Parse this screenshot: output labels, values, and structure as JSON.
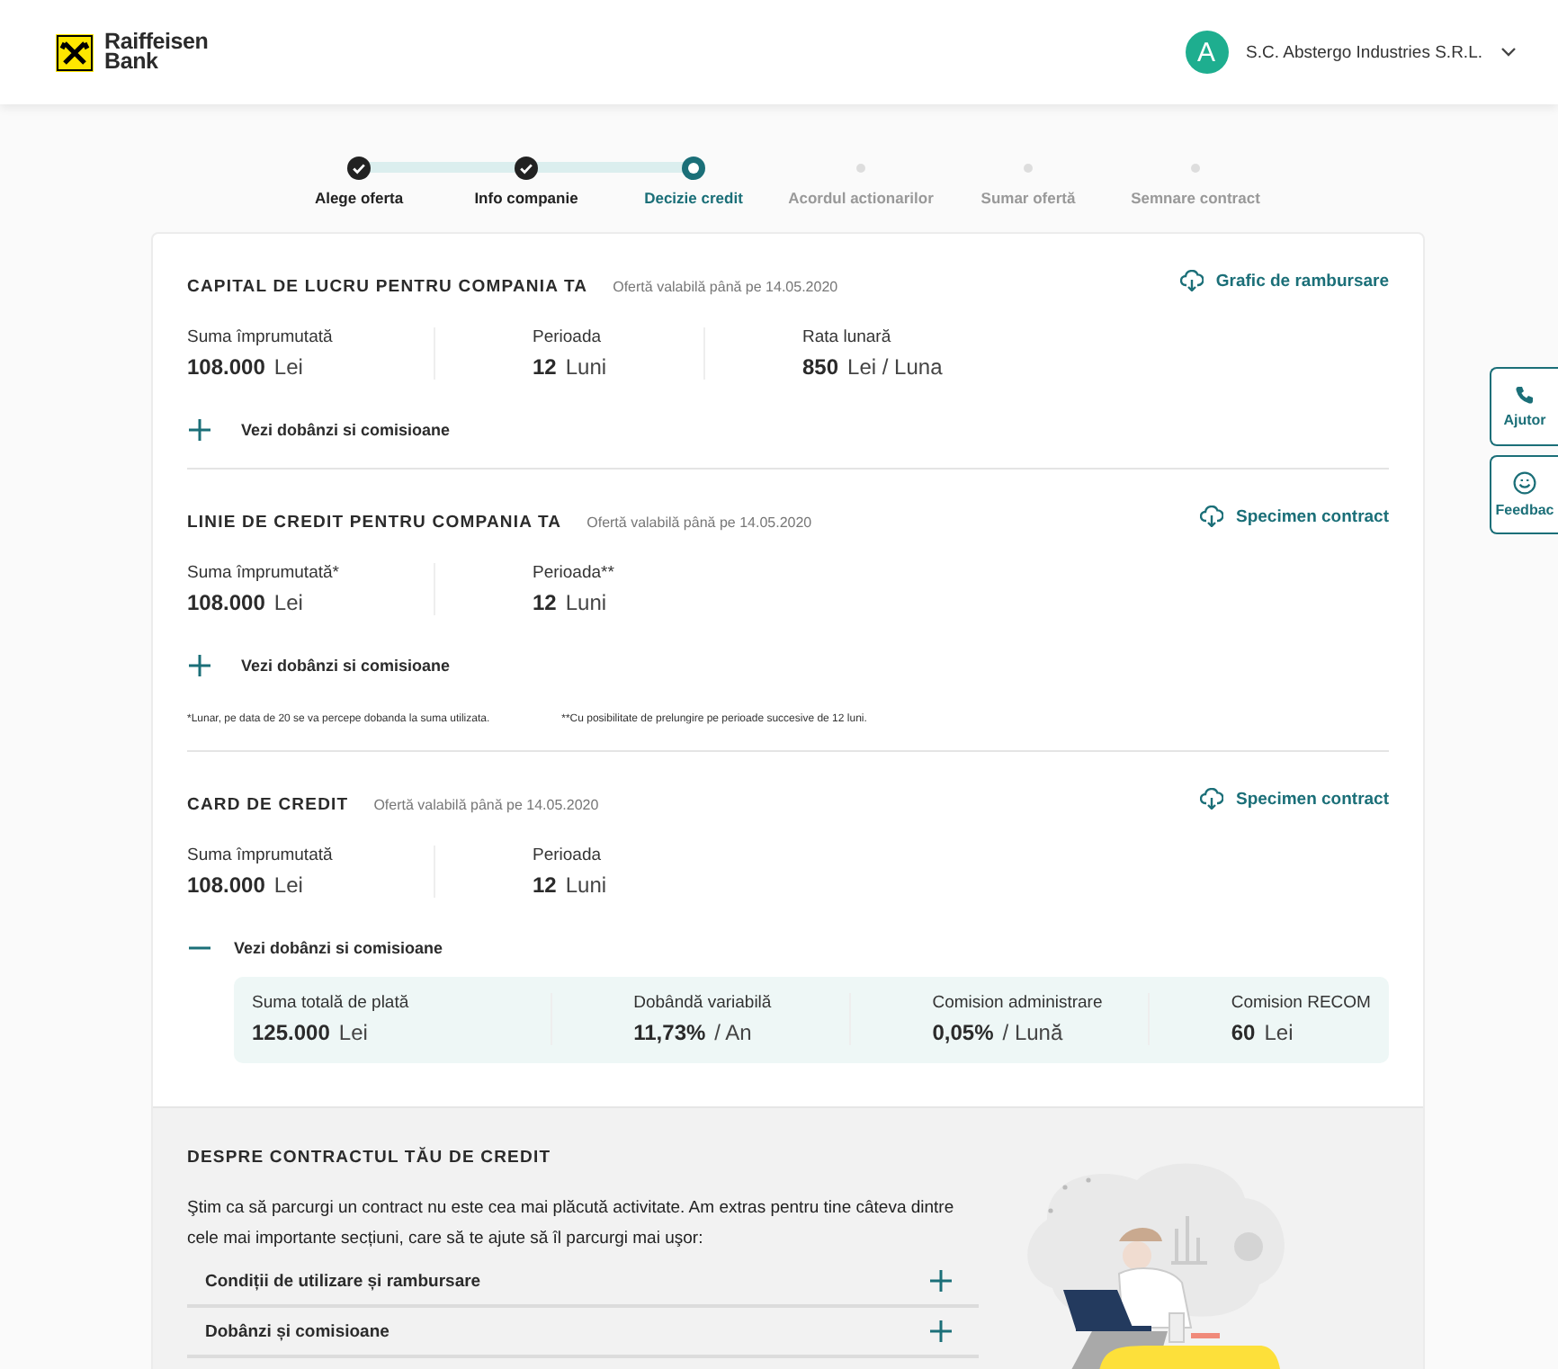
{
  "header": {
    "logo_text": "Raiffeisen Bank",
    "avatar": "A",
    "company": "S.C. Abstergo Industries S.R.L."
  },
  "steps": [
    {
      "label": "Alege oferta",
      "completed": true,
      "selected": false
    },
    {
      "label": "Info companie",
      "completed": true,
      "selected": false
    },
    {
      "label": "Decizie credit",
      "completed": false,
      "selected": true
    },
    {
      "label": "Acordul actionarilor",
      "completed": false,
      "selected": false
    },
    {
      "label": "Sumar ofertă",
      "completed": false,
      "selected": false
    },
    {
      "label": "Semnare contract",
      "completed": false,
      "selected": false
    }
  ],
  "offers": [
    {
      "title": "CAPITAL DE LUCRU PENTRU COMPANIA TA",
      "validity": "Ofertă valabilă până pe 14.05.2020",
      "link": "Grafic de rambursare",
      "fields": [
        {
          "label": "Suma împrumutată",
          "value": "108.000",
          "unit": "Lei"
        },
        {
          "label": "Perioada",
          "value": "12",
          "unit": "Luni"
        },
        {
          "label": "Rata lunară",
          "value": "850",
          "unit": "Lei / Luna"
        }
      ],
      "expander": {
        "label": "Vezi dobânzi si comisioane",
        "expanded": false
      }
    },
    {
      "title": "LINIE DE CREDIT PENTRU COMPANIA TA",
      "validity": "Ofertă valabilă până pe 14.05.2020",
      "link": "Specimen contract",
      "fields": [
        {
          "label": "Suma împrumutată*",
          "value": "108.000",
          "unit": "Lei"
        },
        {
          "label": "Perioada**",
          "value": "12",
          "unit": "Luni"
        }
      ],
      "expander": {
        "label": "Vezi dobânzi si comisioane",
        "expanded": false
      },
      "footnotes": [
        "*Lunar, pe data de 20 se va percepe dobanda la suma utilizata.",
        "**Cu posibilitate de prelungire pe perioade succesive de 12 luni."
      ]
    },
    {
      "title": "CARD DE CREDIT",
      "validity": "Ofertă valabilă până pe 14.05.2020",
      "link": "Specimen contract",
      "fields": [
        {
          "label": "Suma împrumutată",
          "value": "108.000",
          "unit": "Lei"
        },
        {
          "label": "Perioada",
          "value": "12",
          "unit": "Luni"
        }
      ],
      "expander": {
        "label": "Vezi dobânzi si comisioane",
        "expanded": true
      },
      "details": [
        {
          "label": "Suma totală de plată",
          "value": "125.000",
          "unit": "Lei"
        },
        {
          "label": "Dobândă variabilă",
          "value": "11,73%",
          "unit": "/ An"
        },
        {
          "label": "Comision administrare",
          "value": "0,05%",
          "unit": "/ Lună"
        },
        {
          "label": "Comision RECOM",
          "value": "60",
          "unit": "Lei"
        }
      ]
    }
  ],
  "contract_info": {
    "title": "DESPRE CONTRACTUL TĂU DE CREDIT",
    "text": "Ştim ca să parcurgi un contract nu este cea mai plăcută activitate. Am extras pentru tine câteva dintre cele mai importante secțiuni, care să te ajute să îl parcurgi mai uşor:",
    "sections": [
      {
        "label": "Condiții de utilizare și rambursare",
        "expanded": false
      },
      {
        "label": "Dobânzi și comisioane",
        "expanded": false
      }
    ]
  },
  "side_buttons": [
    {
      "kind": "phone",
      "label": "Ajutor"
    },
    {
      "kind": "smile",
      "label": "Feedbac"
    }
  ]
}
